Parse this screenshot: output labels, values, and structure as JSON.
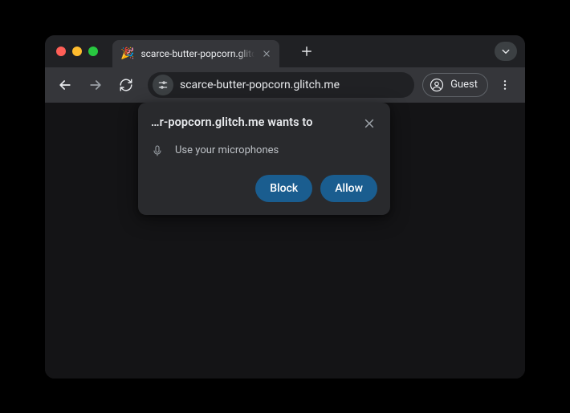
{
  "tab": {
    "favicon": "🎉",
    "title": "scarce-butter-popcorn.glitch"
  },
  "address": {
    "url": "scarce-butter-popcorn.glitch.me"
  },
  "profile": {
    "label": "Guest"
  },
  "permission_dialog": {
    "title": "…r-popcorn.glitch.me wants to",
    "item": "Use your microphones",
    "block_label": "Block",
    "allow_label": "Allow"
  }
}
